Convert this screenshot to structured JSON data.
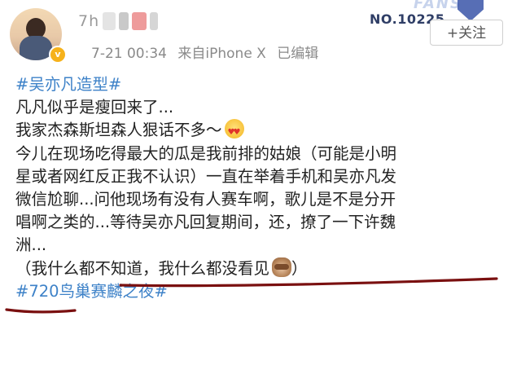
{
  "header": {
    "username_visible": "7h",
    "meta": {
      "time": "7-21 00:34",
      "source": "来自iPhone X",
      "edited": "已编辑"
    },
    "fans_badge": {
      "word": "FANS",
      "number": "NO.10225"
    },
    "follow_label": "+关注"
  },
  "post": {
    "lines": [
      {
        "hashtag": "#吴亦凡造型#"
      },
      {
        "text": "凡凡似乎是瘦回来了..."
      },
      {
        "text": "我家杰森斯坦森人狠话不多～"
      },
      {
        "text": "今儿在现场吃得最大的瓜是我前排的姑娘（可能是小明"
      },
      {
        "text": "星或者网红反正我不认识）一直在举着手机和吴亦凡发"
      },
      {
        "text": "微信尬聊...问他现场有没有人赛车啊，歌儿是不是分开"
      },
      {
        "text": "唱啊之类的...等待吴亦凡回复期间，还，撩了一下许魏"
      },
      {
        "text": "洲..."
      },
      {
        "text": "（我什么都不知道，我什么都没看见"
      },
      {
        "hashtag": "#720鸟巢赛麟之夜#"
      }
    ],
    "emojis": {
      "line3": "heart-eyes-emoji",
      "line9": "see-no-evil-monkey-emoji"
    }
  },
  "colors": {
    "hashtag": "#3e82c8",
    "underline": "#7a1010",
    "meta_text": "#8a8a8a"
  }
}
